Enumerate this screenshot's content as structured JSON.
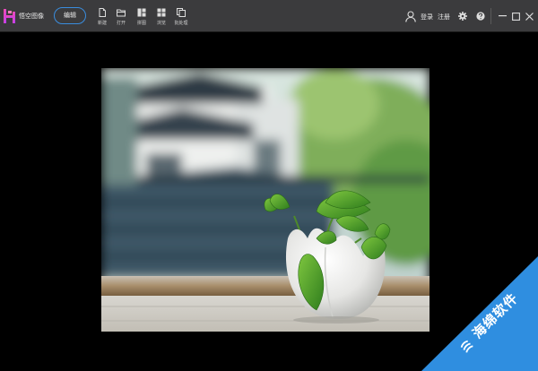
{
  "app": {
    "name": "悟空图像"
  },
  "toolbar": {
    "edit_label": "编辑",
    "tools": [
      {
        "label": "新建",
        "icon": "new-file-icon"
      },
      {
        "label": "打开",
        "icon": "open-folder-icon"
      },
      {
        "label": "拼图",
        "icon": "collage-icon"
      },
      {
        "label": "浏览",
        "icon": "browse-grid-icon"
      },
      {
        "label": "批处理",
        "icon": "batch-icon"
      }
    ]
  },
  "header": {
    "login_label": "登录",
    "register_label": "注册"
  },
  "colors": {
    "titlebar": "#3b3b3d",
    "accent": "#3a8dde",
    "watermark": "#2f8ee0",
    "logo": "#e83e8c"
  },
  "watermark": {
    "text": "海绵软件"
  }
}
